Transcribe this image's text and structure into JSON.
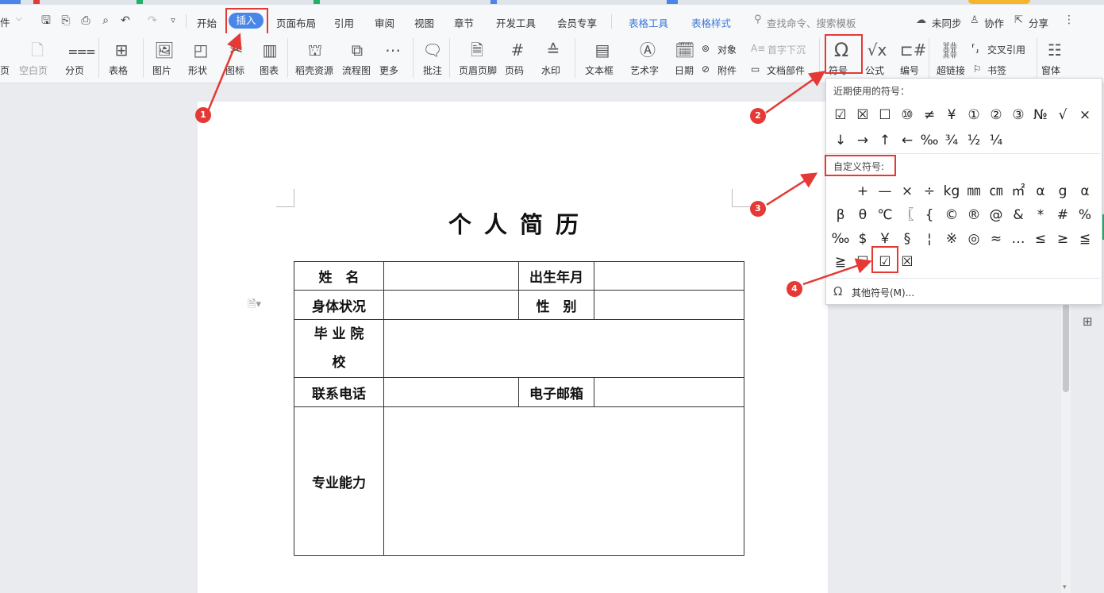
{
  "menu": {
    "file": "件",
    "items": [
      "开始",
      "插入",
      "页面布局",
      "引用",
      "审阅",
      "视图",
      "章节",
      "开发工具",
      "会员专享"
    ],
    "table_tools": "表格工具",
    "table_style": "表格样式",
    "search_placeholder": "查找命令、搜索模板",
    "unsynced": "未同步",
    "collab": "协作",
    "share": "分享"
  },
  "ribbon": {
    "page_label": "页",
    "blank_page": "空白页",
    "page_break": "分页",
    "table": "表格",
    "picture": "图片",
    "shape": "形状",
    "icon": "图标",
    "chart": "图表",
    "daoke": "稻壳资源",
    "flowchart": "流程图",
    "more": "更多",
    "comment": "批注",
    "header_footer": "页眉页脚",
    "page_num": "页码",
    "watermark": "水印",
    "textbox": "文本框",
    "wordart": "艺术字",
    "date": "日期",
    "object": "对象",
    "attachment": "附件",
    "dropcap": "首字下沉",
    "docpart": "文档部件",
    "symbol": "符号",
    "formula": "公式",
    "numbering": "编号",
    "crossref": "交叉引用",
    "hyperlink": "超链接",
    "bookmark": "书签",
    "window": "窗体"
  },
  "document": {
    "title": "个人简历",
    "table": {
      "name": "姓　名",
      "birth": "出生年月",
      "health": "身体状况",
      "gender": "性　别",
      "school_1": "毕 业 院",
      "school_2": "校",
      "phone": "联系电话",
      "email": "电子邮箱",
      "skills": "专业能力"
    }
  },
  "symbol_panel": {
    "recent_title": "近期使用的符号：",
    "recent_row1": [
      "☑",
      "☒",
      "☐",
      "⑩",
      "≠",
      "¥",
      "①",
      "②",
      "③",
      "№",
      "√",
      "×"
    ],
    "recent_row2": [
      "↓",
      "→",
      "↑",
      "←",
      "‰",
      "¾",
      "½",
      "¼"
    ],
    "custom_title": "自定义符号:",
    "custom_row1": [
      "",
      "+",
      "—",
      "×",
      "÷",
      "kg",
      "㎜",
      "㎝",
      "㎡",
      "α",
      "g",
      "α"
    ],
    "custom_row2": [
      "β",
      "θ",
      "℃",
      "〖",
      "{",
      "©",
      "®",
      "@",
      "&",
      "*",
      "#",
      "%"
    ],
    "custom_row3": [
      "‰",
      "$",
      "￥",
      "§",
      "¦",
      "※",
      "◎",
      "≈",
      "…",
      "≤",
      "≥",
      "≦"
    ],
    "custom_row4": [
      "≧",
      "☐",
      "☑",
      "☒"
    ],
    "more_symbols": "其他符号(M)..."
  },
  "annotations": [
    "1",
    "2",
    "3",
    "4"
  ],
  "colors": {
    "accent": "#4a86e8",
    "annotation_red": "#e53935"
  }
}
